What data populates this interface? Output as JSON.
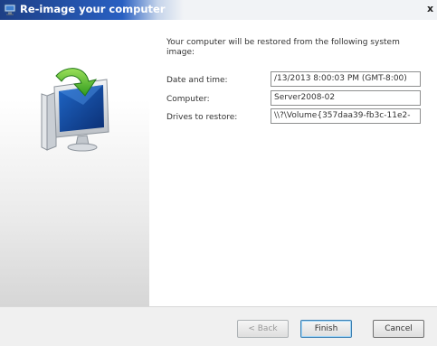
{
  "window": {
    "title": "Re-image your computer",
    "close_label": "x"
  },
  "content": {
    "intro": "Your computer will be restored from the following system image:",
    "fields": [
      {
        "label": "Date and time:",
        "value": "/13/2013 8:00:03 PM (GMT-8:00)"
      },
      {
        "label": "Computer:",
        "value": "Server2008-02"
      },
      {
        "label": "Drives to restore:",
        "value": "\\\\?\\Volume{357daa39-fb3c-11e2-"
      }
    ]
  },
  "footer": {
    "back_label": "< Back",
    "finish_label": "Finish",
    "cancel_label": "Cancel"
  },
  "icons": [
    "title-app-icon",
    "restore-computer-icon",
    "close-icon"
  ],
  "colors": {
    "titlebar": "#2556b6",
    "footer": "#f0f0f0",
    "default_button": "#3c7fb1"
  }
}
